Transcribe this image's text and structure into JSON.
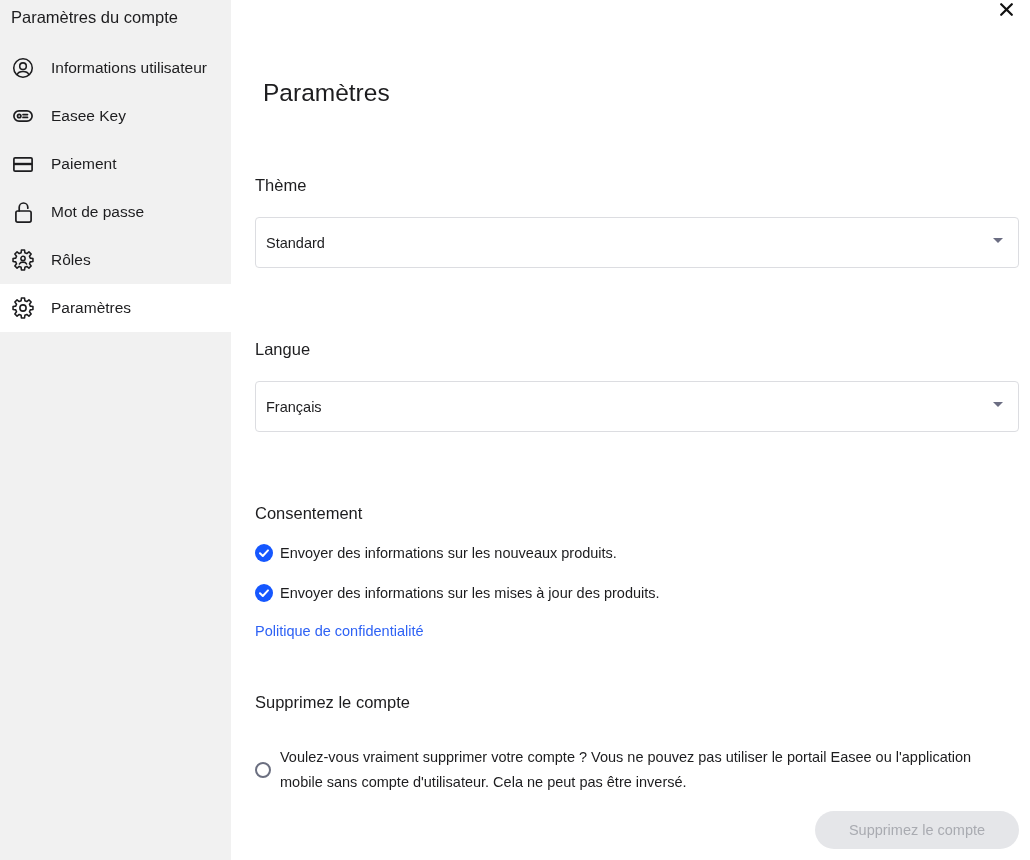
{
  "sidebar": {
    "title": "Paramètres du compte",
    "items": [
      {
        "label": "Informations utilisateur",
        "kind": "user",
        "selected": false
      },
      {
        "label": "Easee Key",
        "kind": "key",
        "selected": false
      },
      {
        "label": "Paiement",
        "kind": "card",
        "selected": false
      },
      {
        "label": "Mot de passe",
        "kind": "lock",
        "selected": false
      },
      {
        "label": "Rôles",
        "kind": "roles",
        "selected": false
      },
      {
        "label": "Paramètres",
        "kind": "gear",
        "selected": true
      }
    ]
  },
  "page": {
    "title": "Paramètres"
  },
  "sections": [
    {
      "kind": "select",
      "title": "Thème",
      "value": "Standard"
    },
    {
      "kind": "select",
      "title": "Langue",
      "value": "Français"
    },
    {
      "kind": "consent",
      "title": "Consentement",
      "options": [
        {
          "label": "Envoyer des informations sur les nouveaux produits.",
          "checked": true
        },
        {
          "label": "Envoyer des informations sur les mises à jour des produits.",
          "checked": true
        }
      ],
      "link": "Politique de confidentialité"
    },
    {
      "kind": "delete",
      "title": "Supprimez le compte",
      "confirm": {
        "label": "Voulez-vous vraiment supprimer votre compte ? Vous ne pouvez pas utiliser le portail Easee ou l'application mobile sans compte d'utilisateur. Cela ne peut pas être inversé.",
        "checked": false
      },
      "button": {
        "label": "Supprimez le compte",
        "disabled": true
      }
    }
  ]
}
